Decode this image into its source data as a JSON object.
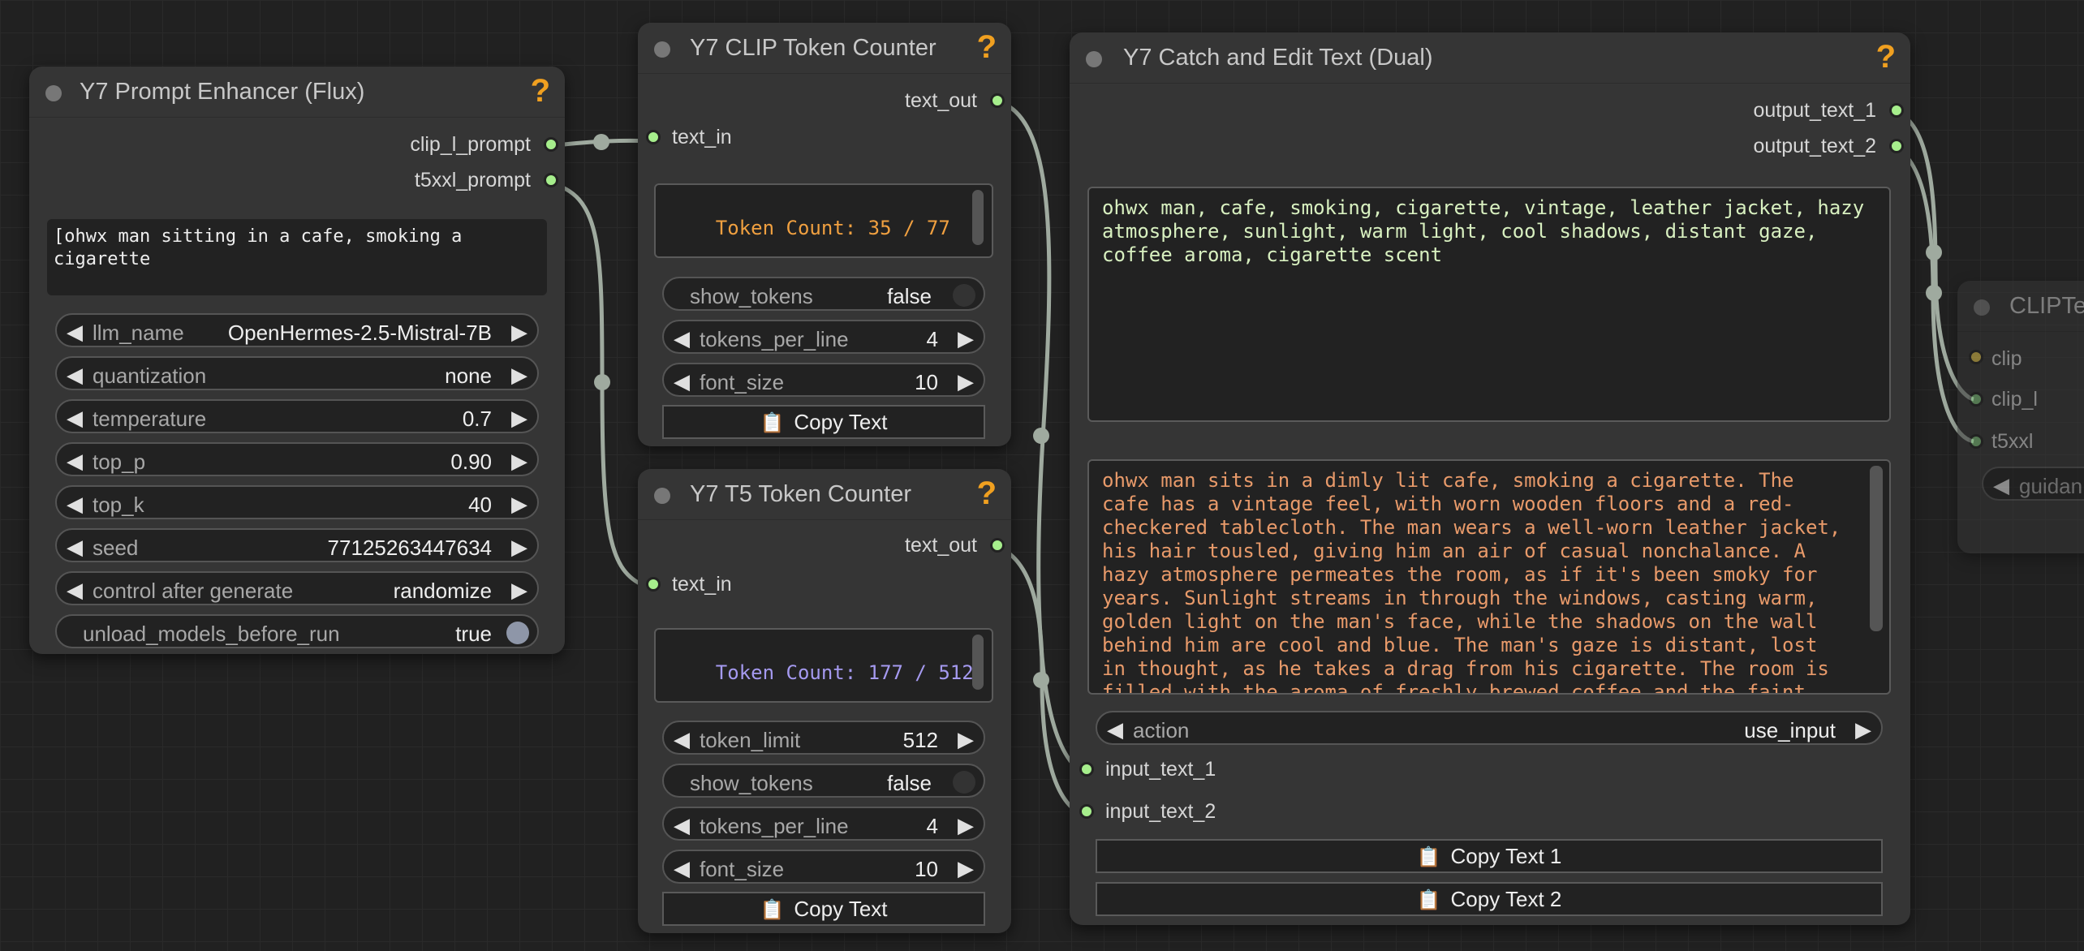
{
  "prompt_enhancer": {
    "title": "Y7 Prompt Enhancer (Flux)",
    "help": "?",
    "outputs": [
      "clip_l_prompt",
      "t5xxl_prompt"
    ],
    "prompt_text": "[ohwx man sitting in a cafe, smoking a\ncigarette",
    "widgets": [
      {
        "label": "llm_name",
        "value": "OpenHermes-2.5-Mistral-7B"
      },
      {
        "label": "quantization",
        "value": "none"
      },
      {
        "label": "temperature",
        "value": "0.7"
      },
      {
        "label": "top_p",
        "value": "0.90"
      },
      {
        "label": "top_k",
        "value": "40"
      },
      {
        "label": "seed",
        "value": "77125263447634"
      },
      {
        "label": "control after generate",
        "value": "randomize"
      }
    ],
    "toggle": {
      "label": "unload_models_before_run",
      "value": "true"
    }
  },
  "clip_counter": {
    "title": "Y7 CLIP Token Counter",
    "help": "?",
    "output": "text_out",
    "input": "text_in",
    "count_text": "Token Count: 35 / 77",
    "count_color": "#f0a040",
    "toggle": {
      "label": "show_tokens",
      "value": "false"
    },
    "widgets": [
      {
        "label": "tokens_per_line",
        "value": "4"
      },
      {
        "label": "font_size",
        "value": "10"
      }
    ],
    "button": "Copy Text"
  },
  "t5_counter": {
    "title": "Y7 T5 Token Counter",
    "help": "?",
    "output": "text_out",
    "input": "text_in",
    "count_text": "Token Count: 177 / 512",
    "count_color": "#a59af0",
    "token_limit": {
      "label": "token_limit",
      "value": "512"
    },
    "toggle": {
      "label": "show_tokens",
      "value": "false"
    },
    "widgets": [
      {
        "label": "tokens_per_line",
        "value": "4"
      },
      {
        "label": "font_size",
        "value": "10"
      }
    ],
    "button": "Copy Text"
  },
  "catch_edit": {
    "title": "Y7 Catch and Edit Text (Dual)",
    "help": "?",
    "outputs": [
      "output_text_1",
      "output_text_2"
    ],
    "text_1": "ohwx man, cafe, smoking, cigarette, vintage, leather jacket, hazy\natmosphere, sunlight, warm light, cool shadows, distant gaze,\ncoffee aroma, cigarette scent",
    "text_2": "ohwx man sits in a dimly lit cafe, smoking a cigarette. The\ncafe has a vintage feel, with worn wooden floors and a red-\ncheckered tablecloth. The man wears a well-worn leather jacket,\nhis hair tousled, giving him an air of casual nonchalance. A\nhazy atmosphere permeates the room, as if it's been smoky for\nyears. Sunlight streams in through the windows, casting warm,\ngolden light on the man's face, while the shadows on the wall\nbehind him are cool and blue. The man's gaze is distant, lost\nin thought, as he takes a drag from his cigarette. The room is\nfilled with the aroma of freshly brewed coffee and the faint",
    "text_1_color": "#d8f0c0",
    "text_2_color": "#e89a6a",
    "action": {
      "label": "action",
      "value": "use_input"
    },
    "inputs": [
      "input_text_1",
      "input_text_2"
    ],
    "buttons": [
      "Copy Text 1",
      "Copy Text 2"
    ]
  },
  "clip_encode": {
    "title": "CLIPTe",
    "inputs": [
      "clip",
      "clip_l",
      "t5xxl"
    ],
    "widget": "guidan"
  },
  "icons": {
    "arrow_left": "◀",
    "arrow_right": "▶",
    "clipboard": "📋"
  }
}
